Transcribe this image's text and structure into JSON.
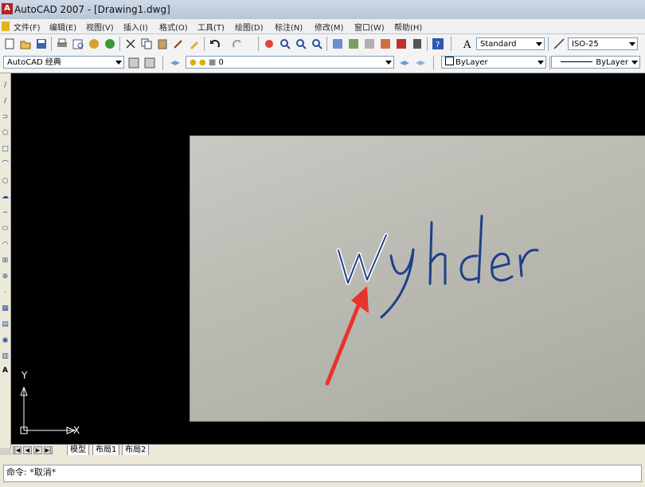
{
  "window": {
    "title": "AutoCAD 2007 - [Drawing1.dwg]",
    "app_icon": "A"
  },
  "menu": [
    {
      "label": "文件(F)"
    },
    {
      "label": "编辑(E)"
    },
    {
      "label": "视图(V)"
    },
    {
      "label": "插入(I)"
    },
    {
      "label": "格式(O)"
    },
    {
      "label": "工具(T)"
    },
    {
      "label": "绘图(D)"
    },
    {
      "label": "标注(N)"
    },
    {
      "label": "修改(M)"
    },
    {
      "label": "窗口(W)"
    },
    {
      "label": "帮助(H)"
    }
  ],
  "toolbar": {
    "text_style": "Standard",
    "dim_style": "ISO-25",
    "workspace": "AutoCAD 经典",
    "layer": "0",
    "color": "ByLayer",
    "linetype": "ByLayer"
  },
  "canvas": {
    "photo_text": "Wyhder",
    "ucs_x": "X",
    "ucs_y": "Y"
  },
  "tabs": [
    {
      "label": "模型",
      "active": true
    },
    {
      "label": "布局1",
      "active": false
    },
    {
      "label": "布局2",
      "active": false
    }
  ],
  "command": {
    "text": "命令: *取消*"
  },
  "colors": {
    "arrow": "#e8352b",
    "ink": "#1f3f8a",
    "canvas_bg": "#000000"
  }
}
